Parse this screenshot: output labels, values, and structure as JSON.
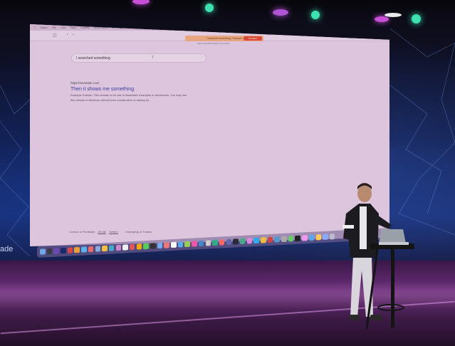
{
  "browser": {
    "menu_items": [
      "Safari",
      "File",
      "Edit",
      "View",
      "History",
      "Bookmarks",
      "Develop",
      "Window",
      "Help"
    ],
    "apple_icon": "apple-icon",
    "clock": "Mon Aug 28  3:47 PM",
    "tab_title": "I searched something | Example",
    "tab_badge": "Pin Bleh",
    "url": "https://searchexample.com/results"
  },
  "search": {
    "query": "I searched something"
  },
  "result": {
    "url": "https://example.com",
    "title": "Then it shows me something",
    "description": "Example Domain. This domain is for use in illustrative examples in documents. You may use this domain in literature without prior coordination or asking for ..."
  },
  "footer": {
    "contact": "Contact & Feedback",
    "email": "(Email",
    "twitter": "Twitter)",
    "changelog": "Changelog & Thanks"
  },
  "stage": {
    "side_text": "ade"
  },
  "colors": {
    "screen": "#ddc6dd",
    "accent_tab": "#e8a67e",
    "link": "#3a3aa0"
  }
}
